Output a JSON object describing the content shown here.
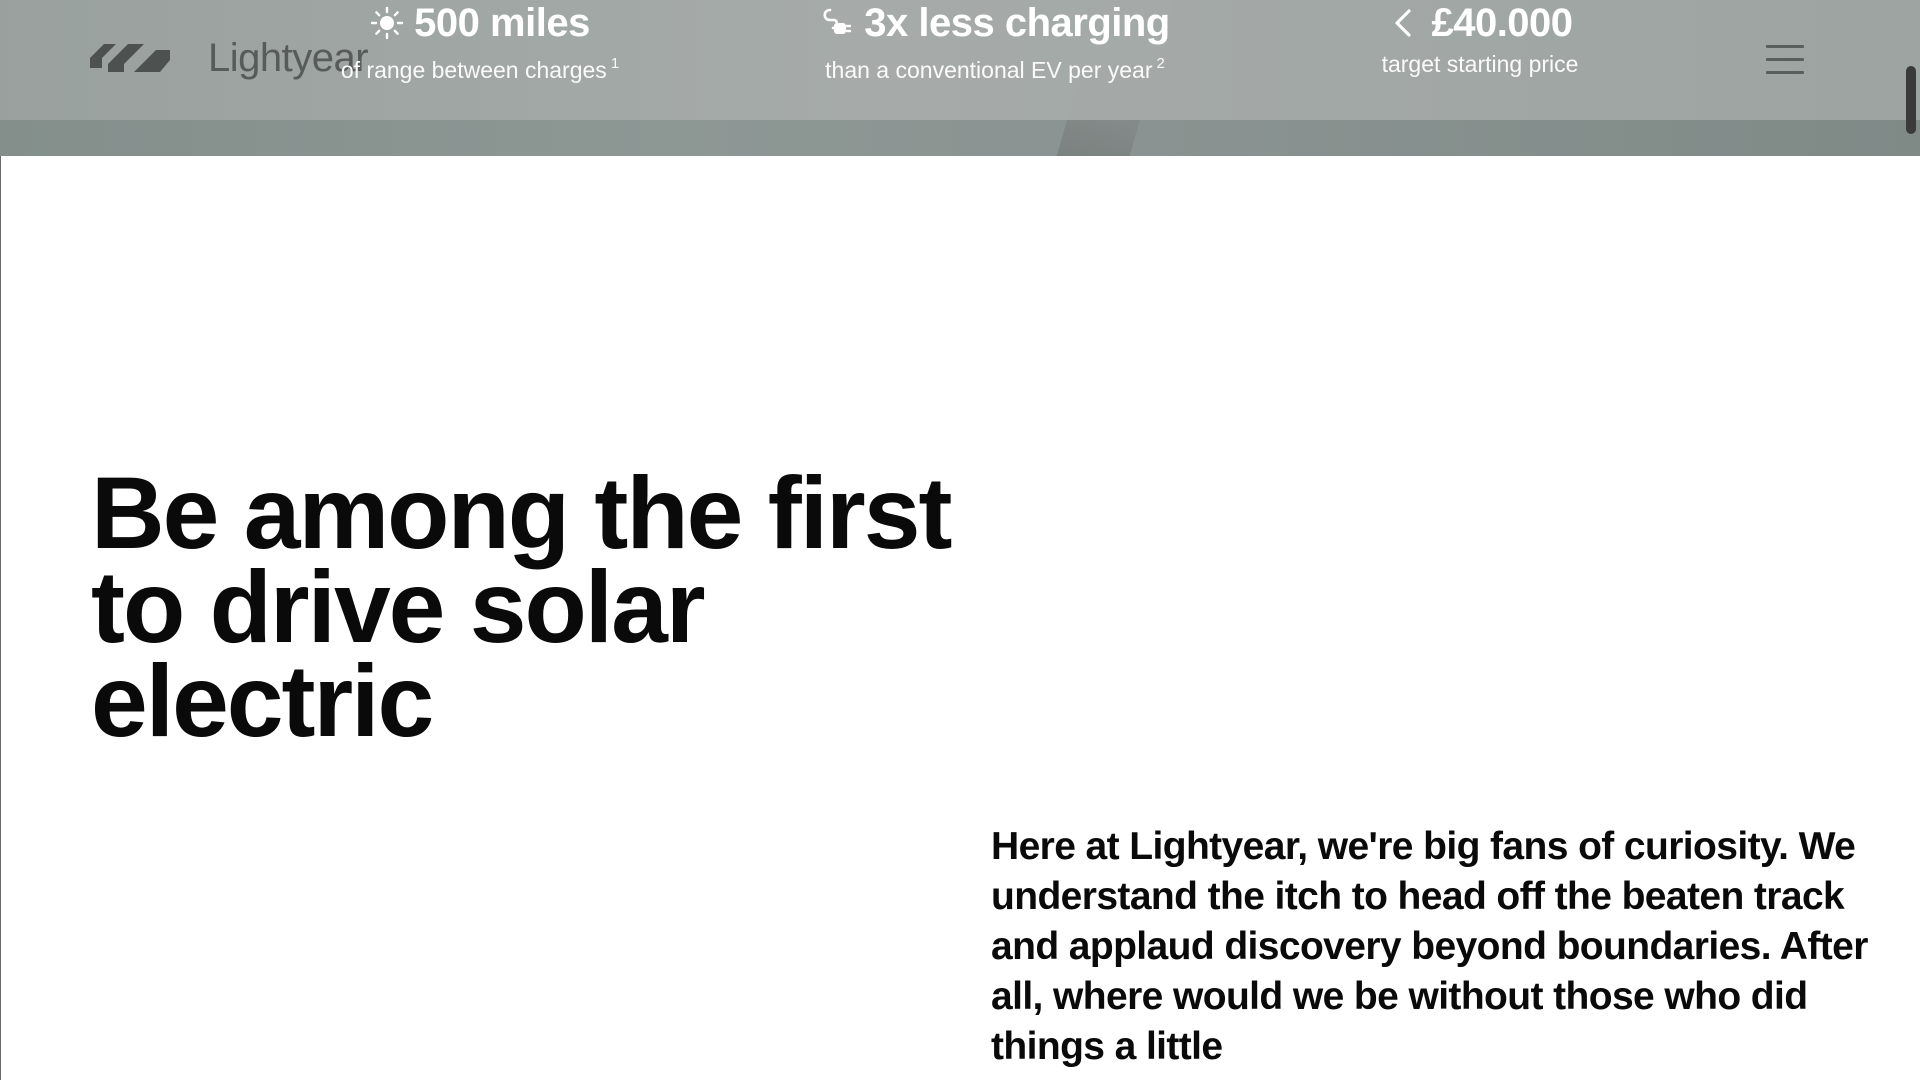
{
  "header": {
    "brand": {
      "name": "Lightyear",
      "logo_icon": "lightyear-logo-icon"
    },
    "stats": [
      {
        "icon": "sun-icon",
        "value": "500 miles",
        "description": "of range between charges",
        "footnote": "1"
      },
      {
        "icon": "charging-plug-icon",
        "value": "3x less charging",
        "description": "than a conventional EV per year",
        "footnote": "2"
      },
      {
        "icon": "less-than-icon",
        "value": "£40.000",
        "description": "target starting price"
      }
    ],
    "menu_icon": "hamburger-menu-icon"
  },
  "main": {
    "headline": "Be among the first to drive solar electric",
    "intro": "Here at Lightyear, we're big fans of curiosity. We understand the itch to head off the beaten track and applaud discovery beyond boundaries. After all, where would we be without those who did things a little"
  },
  "colors": {
    "header_overlay": "#a6abaa",
    "stat_text": "#ffffff",
    "brand_text": "#575c5b",
    "body_text": "#0a0a0a",
    "background": "#ffffff"
  }
}
